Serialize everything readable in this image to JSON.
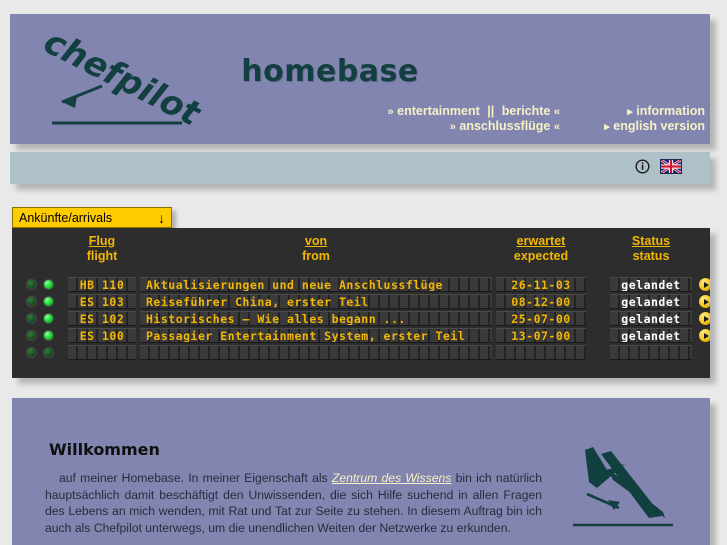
{
  "header": {
    "logo_text": "chefpilot",
    "title": "homebase",
    "nav_center": [
      {
        "label": "entertainment",
        "marker_left": "»",
        "marker_right": ""
      },
      {
        "label": "berichte",
        "marker_left": "",
        "marker_right": "«"
      },
      {
        "label": "anschlussflüge",
        "marker_left": "»",
        "marker_right": "«"
      }
    ],
    "nav_separator": "||",
    "nav_right": [
      {
        "label": "information",
        "marker": "›"
      },
      {
        "label": "english version",
        "marker": "›"
      }
    ]
  },
  "toolbar": {
    "info_icon": "info-circle-icon",
    "flag_icon": "uk-flag-icon"
  },
  "arrivals_tab": {
    "label": "Ankünfte/arrivals",
    "arrow": "↓"
  },
  "board": {
    "columns": [
      {
        "de": "Flug",
        "en": "flight"
      },
      {
        "de": "von",
        "en": "from"
      },
      {
        "de": "erwartet",
        "en": "expected"
      },
      {
        "de": "Status",
        "en": "status"
      }
    ],
    "rows": [
      {
        "flight": "HB 110",
        "from": "Aktualisierungen und neue Anschlussflüge",
        "expected": "26-11-03",
        "status": "gelandet"
      },
      {
        "flight": "ES 103",
        "from": "Reiseführer China, erster Teil",
        "expected": "08-12-00",
        "status": "gelandet"
      },
      {
        "flight": "ES 102",
        "from": "Historisches – Wie alles begann ...",
        "expected": "25-07-00",
        "status": "gelandet"
      },
      {
        "flight": "ES 100",
        "from": "Passagier Entertainment System, erster Teil",
        "expected": "13-07-00",
        "status": "gelandet"
      }
    ]
  },
  "welcome": {
    "heading": "Willkommen",
    "text_before_link": "auf meiner Homebase. In meiner Eigenschaft als ",
    "link_text": "Zentrum des Wissens",
    "text_after_link": " bin ich natürlich hauptsächlich damit beschäftigt den Unwissenden, die sich Hilfe suchend in allen Fragen des Lebens an mich wenden, mit Rat und Tat zur Seite zu stehen. In diesem Auftrag bin ich auch als Chefpilot unterwegs, um die unendlichen Weiten der Netzwerke zu erkunden."
  },
  "colors": {
    "panel_purple": "#8285b0",
    "light_bar": "#aec0c8",
    "board_dark": "#2d2d2d",
    "accent_yellow": "#fc0",
    "board_text": "#f2b705",
    "title_teal": "#123f40",
    "nav_cream": "#f5f2c4",
    "page_bg": "#e9e9e9"
  }
}
